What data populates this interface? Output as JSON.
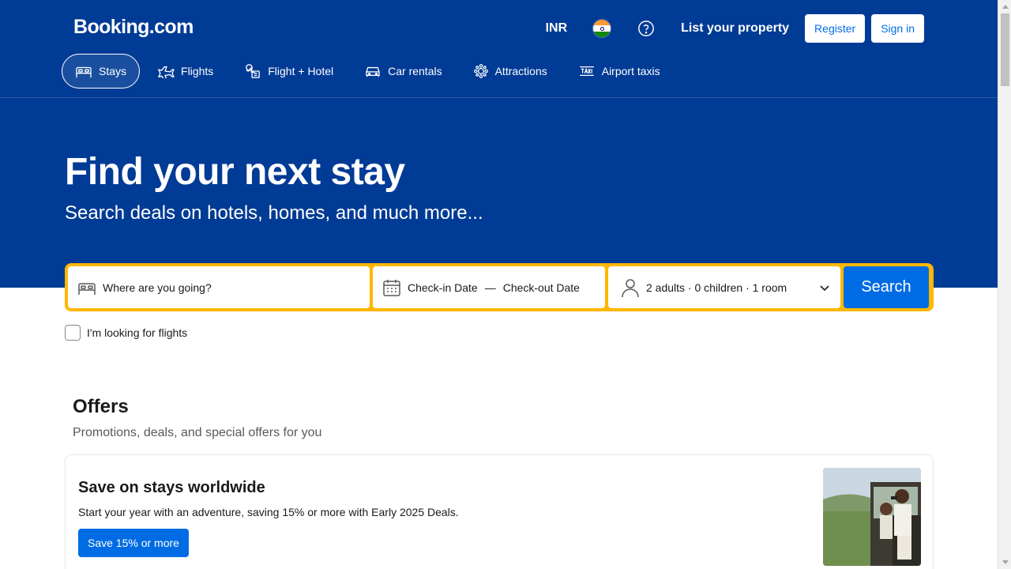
{
  "header": {
    "logo": "Booking.com",
    "currency": "INR",
    "language_flag": "india-flag",
    "help_icon": "question-circle-icon",
    "list_property": "List your property",
    "register": "Register",
    "sign_in": "Sign in"
  },
  "nav": {
    "items": [
      {
        "label": "Stays",
        "icon": "bed-icon",
        "active": true
      },
      {
        "label": "Flights",
        "icon": "plane-icon",
        "active": false
      },
      {
        "label": "Flight + Hotel",
        "icon": "flight-hotel-icon",
        "active": false
      },
      {
        "label": "Car rentals",
        "icon": "car-icon",
        "active": false
      },
      {
        "label": "Attractions",
        "icon": "attractions-icon",
        "active": false
      },
      {
        "label": "Airport taxis",
        "icon": "taxi-icon",
        "active": false
      }
    ]
  },
  "hero": {
    "title": "Find your next stay",
    "subtitle": "Search deals on hotels, homes, and much more..."
  },
  "search": {
    "destination_placeholder": "Where are you going?",
    "checkin": "Check-in Date",
    "dash": "—",
    "checkout": "Check-out Date",
    "guests": "2 adults · 0 children · 1 room",
    "button": "Search",
    "flights_checkbox": "I'm looking for flights"
  },
  "offers": {
    "title": "Offers",
    "subtitle": "Promotions, deals, and special offers for you",
    "card": {
      "title": "Save on stays worldwide",
      "description": "Start your year with an adventure, saving 15% or more with Early 2025 Deals.",
      "button": "Save 15% or more"
    }
  },
  "colors": {
    "brand_blue": "#003b95",
    "action_blue": "#006ce4",
    "search_border": "#ffb700"
  }
}
